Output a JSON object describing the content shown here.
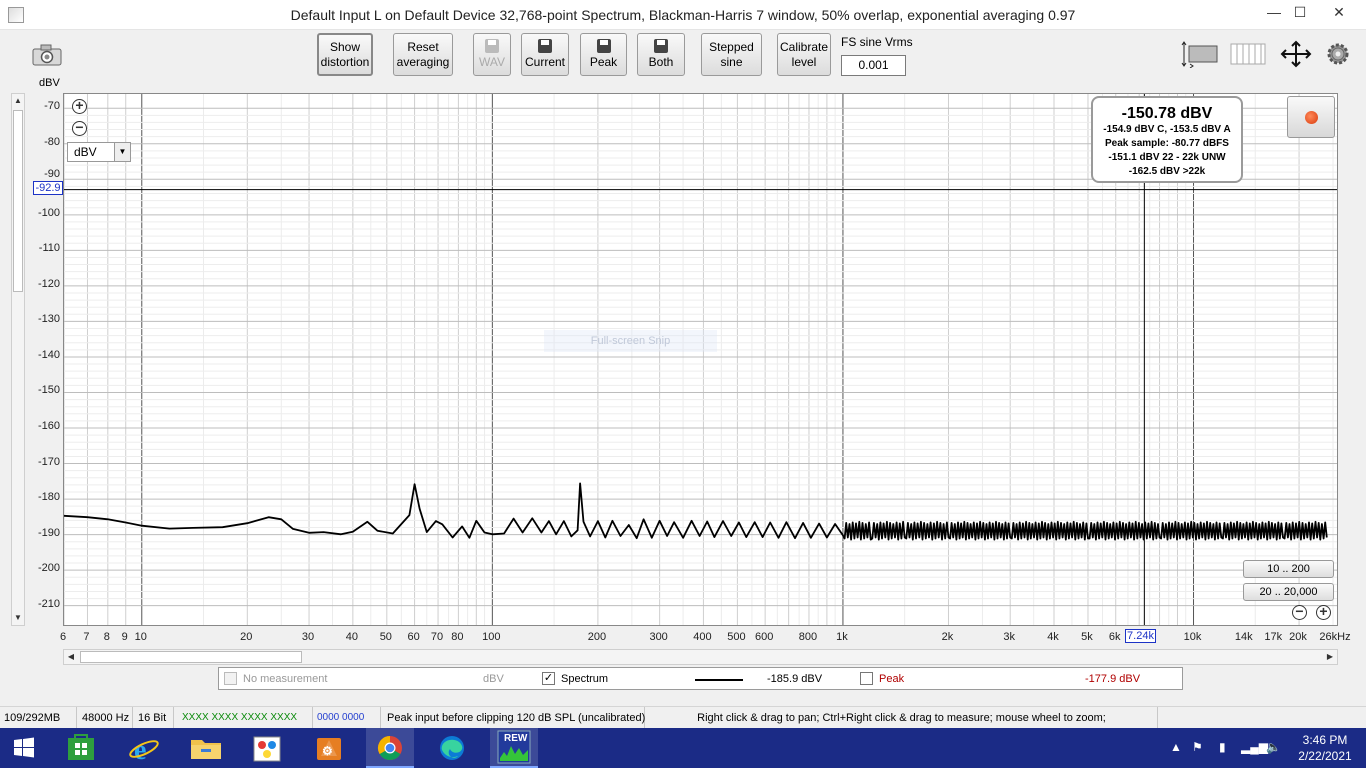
{
  "window": {
    "title": "Default Input L on Default Device 32,768-point Spectrum, Blackman-Harris 7 window, 50% overlap, exponential averaging 0.97",
    "minimize": "—",
    "maximize": "☐",
    "close": "✕"
  },
  "toolbar": {
    "show_distortion": [
      "Show",
      "distortion"
    ],
    "reset_averaging": [
      "Reset",
      "averaging"
    ],
    "wav": "WAV",
    "current": "Current",
    "peak": "Peak",
    "both": "Both",
    "stepped_sine": [
      "Stepped",
      "sine"
    ],
    "calibrate_level": [
      "Calibrate",
      "level"
    ],
    "fs_label": "FS sine Vrms",
    "fs_value": "0.001"
  },
  "axis": {
    "unit": "dBV",
    "y_ticks": [
      "-70",
      "-80",
      "-90",
      "-100",
      "-110",
      "-120",
      "-130",
      "-140",
      "-150",
      "-160",
      "-170",
      "-180",
      "-190",
      "-200",
      "-210"
    ],
    "y_cursor": "-92.9",
    "x_ticks": [
      "6",
      "7",
      "8",
      "9",
      "10",
      "20",
      "30",
      "40",
      "50",
      "60",
      "70",
      "80",
      "100",
      "200",
      "300",
      "400",
      "500",
      "600",
      "800",
      "1k",
      "2k",
      "3k",
      "4k",
      "5k",
      "6k",
      "7.24k",
      "10k",
      "14k",
      "17k",
      "20k",
      "26kHz"
    ],
    "x_cursor": "7.24k"
  },
  "unit_select": "dBV",
  "readout": {
    "main": "-150.78 dBV",
    "line1": "-154.9 dBV C, -153.5 dBV A",
    "line2": "Peak sample: -80.77 dBFS",
    "line3": "-151.1 dBV 22 - 22k UNW",
    "line4": "-162.5 dBV >22k"
  },
  "range_buttons": [
    "10 .. 200",
    "20 .. 20,000"
  ],
  "overlay_text": "Full-screen Snip",
  "legend": {
    "no_measurement": "No measurement",
    "no_measurement_unit": "dBV",
    "spectrum_label": "Spectrum",
    "spectrum_value": "-185.9 dBV",
    "peak_label": "Peak",
    "peak_value": "-177.9 dBV",
    "peak_color": "#b00000"
  },
  "status": {
    "memory": "109/292MB",
    "rate": "48000 Hz",
    "bits": "16 Bit",
    "meter_green": "XXXX XXXX   XXXX XXXX",
    "meter_blue": "0000 0000",
    "clip": "Peak input before clipping 120 dB SPL (uncalibrated)",
    "hint": "Right click & drag to pan; Ctrl+Right click & drag to measure; mouse wheel to zoom;"
  },
  "taskbar": {
    "time": "3:46 PM",
    "date": "2/22/2021",
    "apps": [
      "windows-start",
      "store",
      "internet-explorer",
      "file-explorer",
      "paint",
      "app-generic",
      "chrome",
      "edge",
      "rew"
    ],
    "rew_label": "REW"
  },
  "chart_data": {
    "type": "line",
    "x_scale": "log",
    "xlim": [
      6,
      26000
    ],
    "ylim": [
      -216,
      -66
    ],
    "ylabel": "dBV",
    "series": [
      {
        "name": "Spectrum",
        "color": "#000000",
        "points": [
          [
            6,
            -184.7
          ],
          [
            7,
            -185.1
          ],
          [
            8,
            -185.7
          ],
          [
            9,
            -186.6
          ],
          [
            10,
            -187.5
          ],
          [
            12,
            -188.3
          ],
          [
            14,
            -188.1
          ],
          [
            17,
            -187.9
          ],
          [
            20,
            -186.8
          ],
          [
            23,
            -185.1
          ],
          [
            25,
            -185.7
          ],
          [
            27,
            -188.4
          ],
          [
            30,
            -189.5
          ],
          [
            33,
            -189.3
          ],
          [
            37,
            -189.9
          ],
          [
            40,
            -189.2
          ],
          [
            44,
            -186.4
          ],
          [
            47,
            -188.9
          ],
          [
            52,
            -189.7
          ],
          [
            58,
            -184.5
          ],
          [
            60,
            -175.8
          ],
          [
            62,
            -182.7
          ],
          [
            65,
            -189.3
          ],
          [
            69,
            -186.2
          ],
          [
            72,
            -187.1
          ],
          [
            77,
            -190.8
          ],
          [
            82,
            -187.7
          ],
          [
            86,
            -190.9
          ],
          [
            90,
            -186.1
          ],
          [
            95,
            -189.4
          ],
          [
            100,
            -189.9
          ],
          [
            108,
            -189.7
          ],
          [
            115,
            -185.5
          ],
          [
            122,
            -189.4
          ],
          [
            130,
            -185.4
          ],
          [
            138,
            -189.4
          ],
          [
            145,
            -186.2
          ],
          [
            152,
            -189.9
          ],
          [
            160,
            -186.2
          ],
          [
            168,
            -190.5
          ],
          [
            175,
            -188.8
          ],
          [
            178,
            -175.6
          ],
          [
            182,
            -186.4
          ],
          [
            190,
            -190.5
          ],
          [
            200,
            -186.2
          ],
          [
            210,
            -190.8
          ],
          [
            220,
            -186.1
          ],
          [
            232,
            -190.4
          ],
          [
            245,
            -187.3
          ],
          [
            258,
            -191.0
          ],
          [
            270,
            -185.7
          ],
          [
            285,
            -190.9
          ],
          [
            300,
            -186.1
          ],
          [
            315,
            -190.4
          ],
          [
            330,
            -186.5
          ],
          [
            350,
            -190.9
          ],
          [
            370,
            -186.1
          ],
          [
            390,
            -190.4
          ],
          [
            410,
            -186.3
          ],
          [
            430,
            -190.7
          ],
          [
            455,
            -186.2
          ],
          [
            480,
            -190.4
          ],
          [
            505,
            -186.6
          ],
          [
            530,
            -190.7
          ],
          [
            560,
            -186.5
          ],
          [
            590,
            -190.7
          ],
          [
            620,
            -186.6
          ],
          [
            655,
            -190.9
          ],
          [
            690,
            -186.5
          ],
          [
            730,
            -191.0
          ],
          [
            770,
            -186.7
          ],
          [
            810,
            -190.9
          ],
          [
            855,
            -186.9
          ],
          [
            900,
            -190.8
          ],
          [
            950,
            -187.0
          ],
          [
            1000,
            -190.2
          ],
          [
            1200,
            -187.2
          ],
          [
            1500,
            -191.0
          ],
          [
            2000,
            -186.8
          ],
          [
            3000,
            -191.2
          ],
          [
            5000,
            -186.7
          ],
          [
            8000,
            -191.2
          ],
          [
            12000,
            -186.6
          ],
          [
            18000,
            -191.3
          ],
          [
            24000,
            -186.8
          ]
        ]
      }
    ]
  }
}
